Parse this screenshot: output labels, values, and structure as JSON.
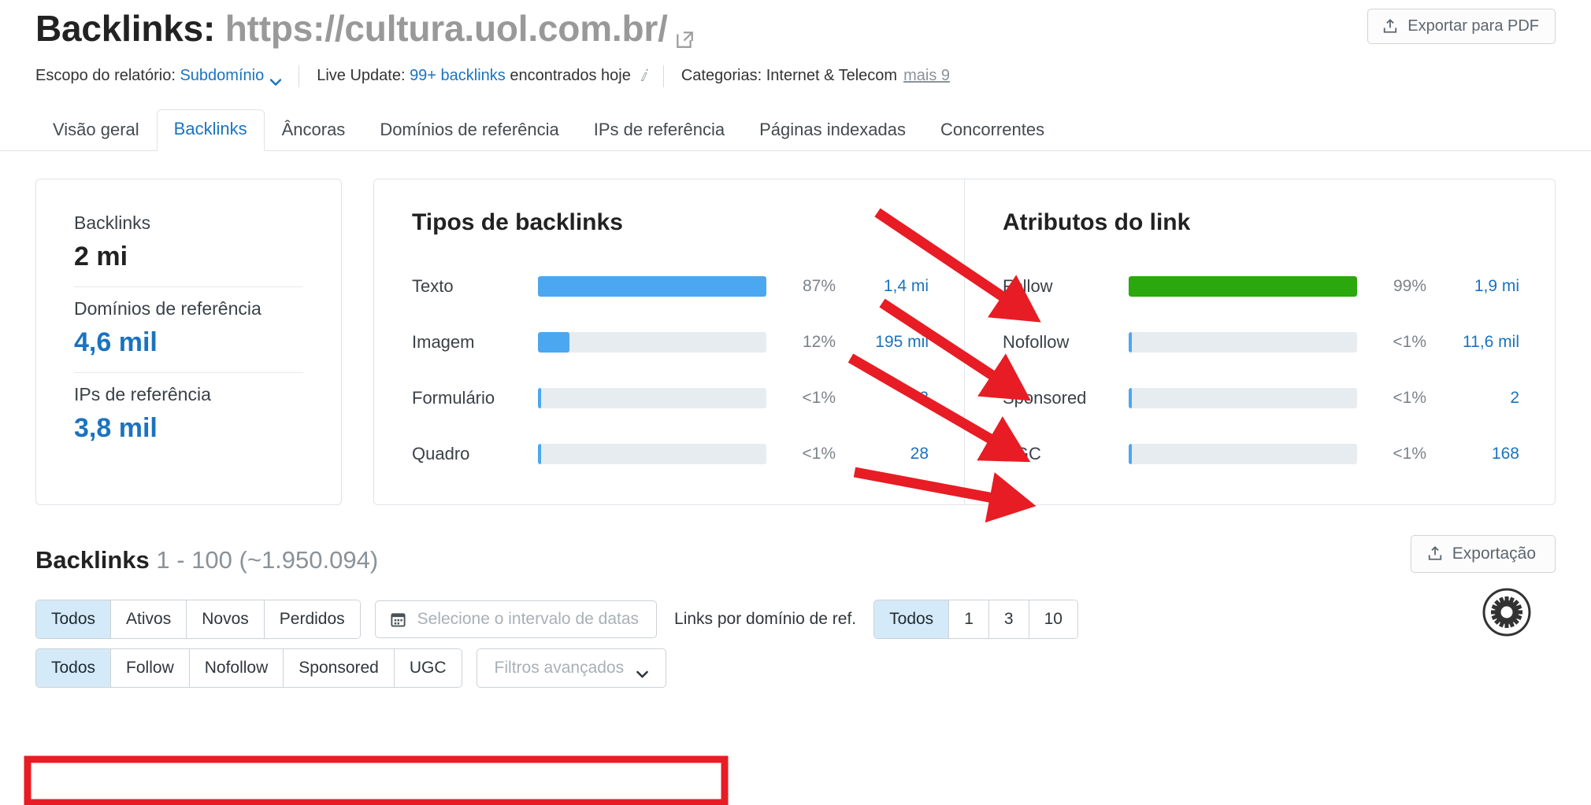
{
  "header": {
    "title_prefix": "Backlinks:",
    "url": "https://cultura.uol.com.br/",
    "external_link_icon": "external-link-icon",
    "export_pdf_label": "Exportar para PDF",
    "export_pdf_icon": "upload-icon"
  },
  "meta": {
    "scope_label": "Escopo do relatório:",
    "scope_value": "Subdomínio",
    "scope_caret_icon": "chevron-down-icon",
    "live_update_label": "Live Update:",
    "live_update_count": "99+ backlinks",
    "live_update_suffix": "encontrados hoje",
    "info_icon": "info-icon",
    "categories_label": "Categorias:",
    "categories_value": "Internet & Telecom",
    "categories_more": "mais 9"
  },
  "tabs": [
    {
      "label": "Visão geral",
      "active": false
    },
    {
      "label": "Backlinks",
      "active": true
    },
    {
      "label": "Âncoras",
      "active": false
    },
    {
      "label": "Domínios de referência",
      "active": false
    },
    {
      "label": "IPs de referência",
      "active": false
    },
    {
      "label": "Páginas indexadas",
      "active": false
    },
    {
      "label": "Concorrentes",
      "active": false
    }
  ],
  "stats": [
    {
      "label": "Backlinks",
      "value": "2 mi",
      "blue": false
    },
    {
      "label": "Domínios de referência",
      "value": "4,6 mil",
      "blue": true
    },
    {
      "label": "IPs de referência",
      "value": "3,8 mil",
      "blue": true
    }
  ],
  "chart_data": [
    {
      "type": "bar",
      "title": "Tipos de backlinks",
      "orientation": "horizontal",
      "categories": [
        "Texto",
        "Imagem",
        "Formulário",
        "Quadro"
      ],
      "values": [
        87,
        12,
        0.5,
        0.5
      ],
      "value_labels": [
        "87%",
        "12%",
        "<1%",
        "<1%"
      ],
      "counts": [
        "1,4 mi",
        "195 mil",
        "3",
        "28"
      ],
      "bar_color": "#4ba7ef",
      "track_color": "#e7ecf1",
      "xlabel": "",
      "ylabel": "",
      "xlim": [
        0,
        100
      ],
      "grid": false,
      "legend": "none"
    },
    {
      "type": "bar",
      "title": "Atributos do link",
      "orientation": "horizontal",
      "categories": [
        "Follow",
        "Nofollow",
        "Sponsored",
        "UGC"
      ],
      "values": [
        99,
        0.5,
        0.5,
        0.5
      ],
      "value_labels": [
        "99%",
        "<1%",
        "<1%",
        "<1%"
      ],
      "counts": [
        "1,9 mi",
        "11,6 mil",
        "2",
        "168"
      ],
      "bar_color": "#2aa80d",
      "small_bar_color": "#4ba7ef",
      "track_color": "#e7ecf1",
      "xlabel": "",
      "ylabel": "",
      "xlim": [
        0,
        100
      ],
      "grid": false,
      "legend": "none"
    }
  ],
  "backlinks_section": {
    "heading_bold": "Backlinks",
    "heading_rest": "1 - 100 (~1.950.094)",
    "export_label": "Exportação",
    "export_icon": "upload-icon",
    "settings_icon": "gear-icon",
    "status_filters": [
      {
        "label": "Todos",
        "active": true
      },
      {
        "label": "Ativos",
        "active": false
      },
      {
        "label": "Novos",
        "active": false
      },
      {
        "label": "Perdidos",
        "active": false
      }
    ],
    "date_range_placeholder": "Selecione o intervalo de datas",
    "date_icon": "calendar-icon",
    "links_per_domain_label": "Links por domínio de ref.",
    "links_per_domain_options": [
      {
        "label": "Todos",
        "active": true
      },
      {
        "label": "1",
        "active": false
      },
      {
        "label": "3",
        "active": false
      },
      {
        "label": "10",
        "active": false
      }
    ],
    "attribute_filters": [
      {
        "label": "Todos",
        "active": true
      },
      {
        "label": "Follow",
        "active": false
      },
      {
        "label": "Nofollow",
        "active": false
      },
      {
        "label": "Sponsored",
        "active": false
      },
      {
        "label": "UGC",
        "active": false
      }
    ],
    "advanced_filters_label": "Filtros avançados",
    "advanced_caret_icon": "chevron-down-icon"
  },
  "colors": {
    "accent_blue": "#1a73c0",
    "bar_blue": "#4ba7ef",
    "bar_green": "#2aa80d",
    "annotation_red": "#e81c24",
    "track_gray": "#e7ecf1",
    "active_seg_bg": "#d5eaf8"
  },
  "annotations": {
    "arrow_count": 4,
    "highlight_box_count": 1,
    "color": "#e81c24"
  }
}
